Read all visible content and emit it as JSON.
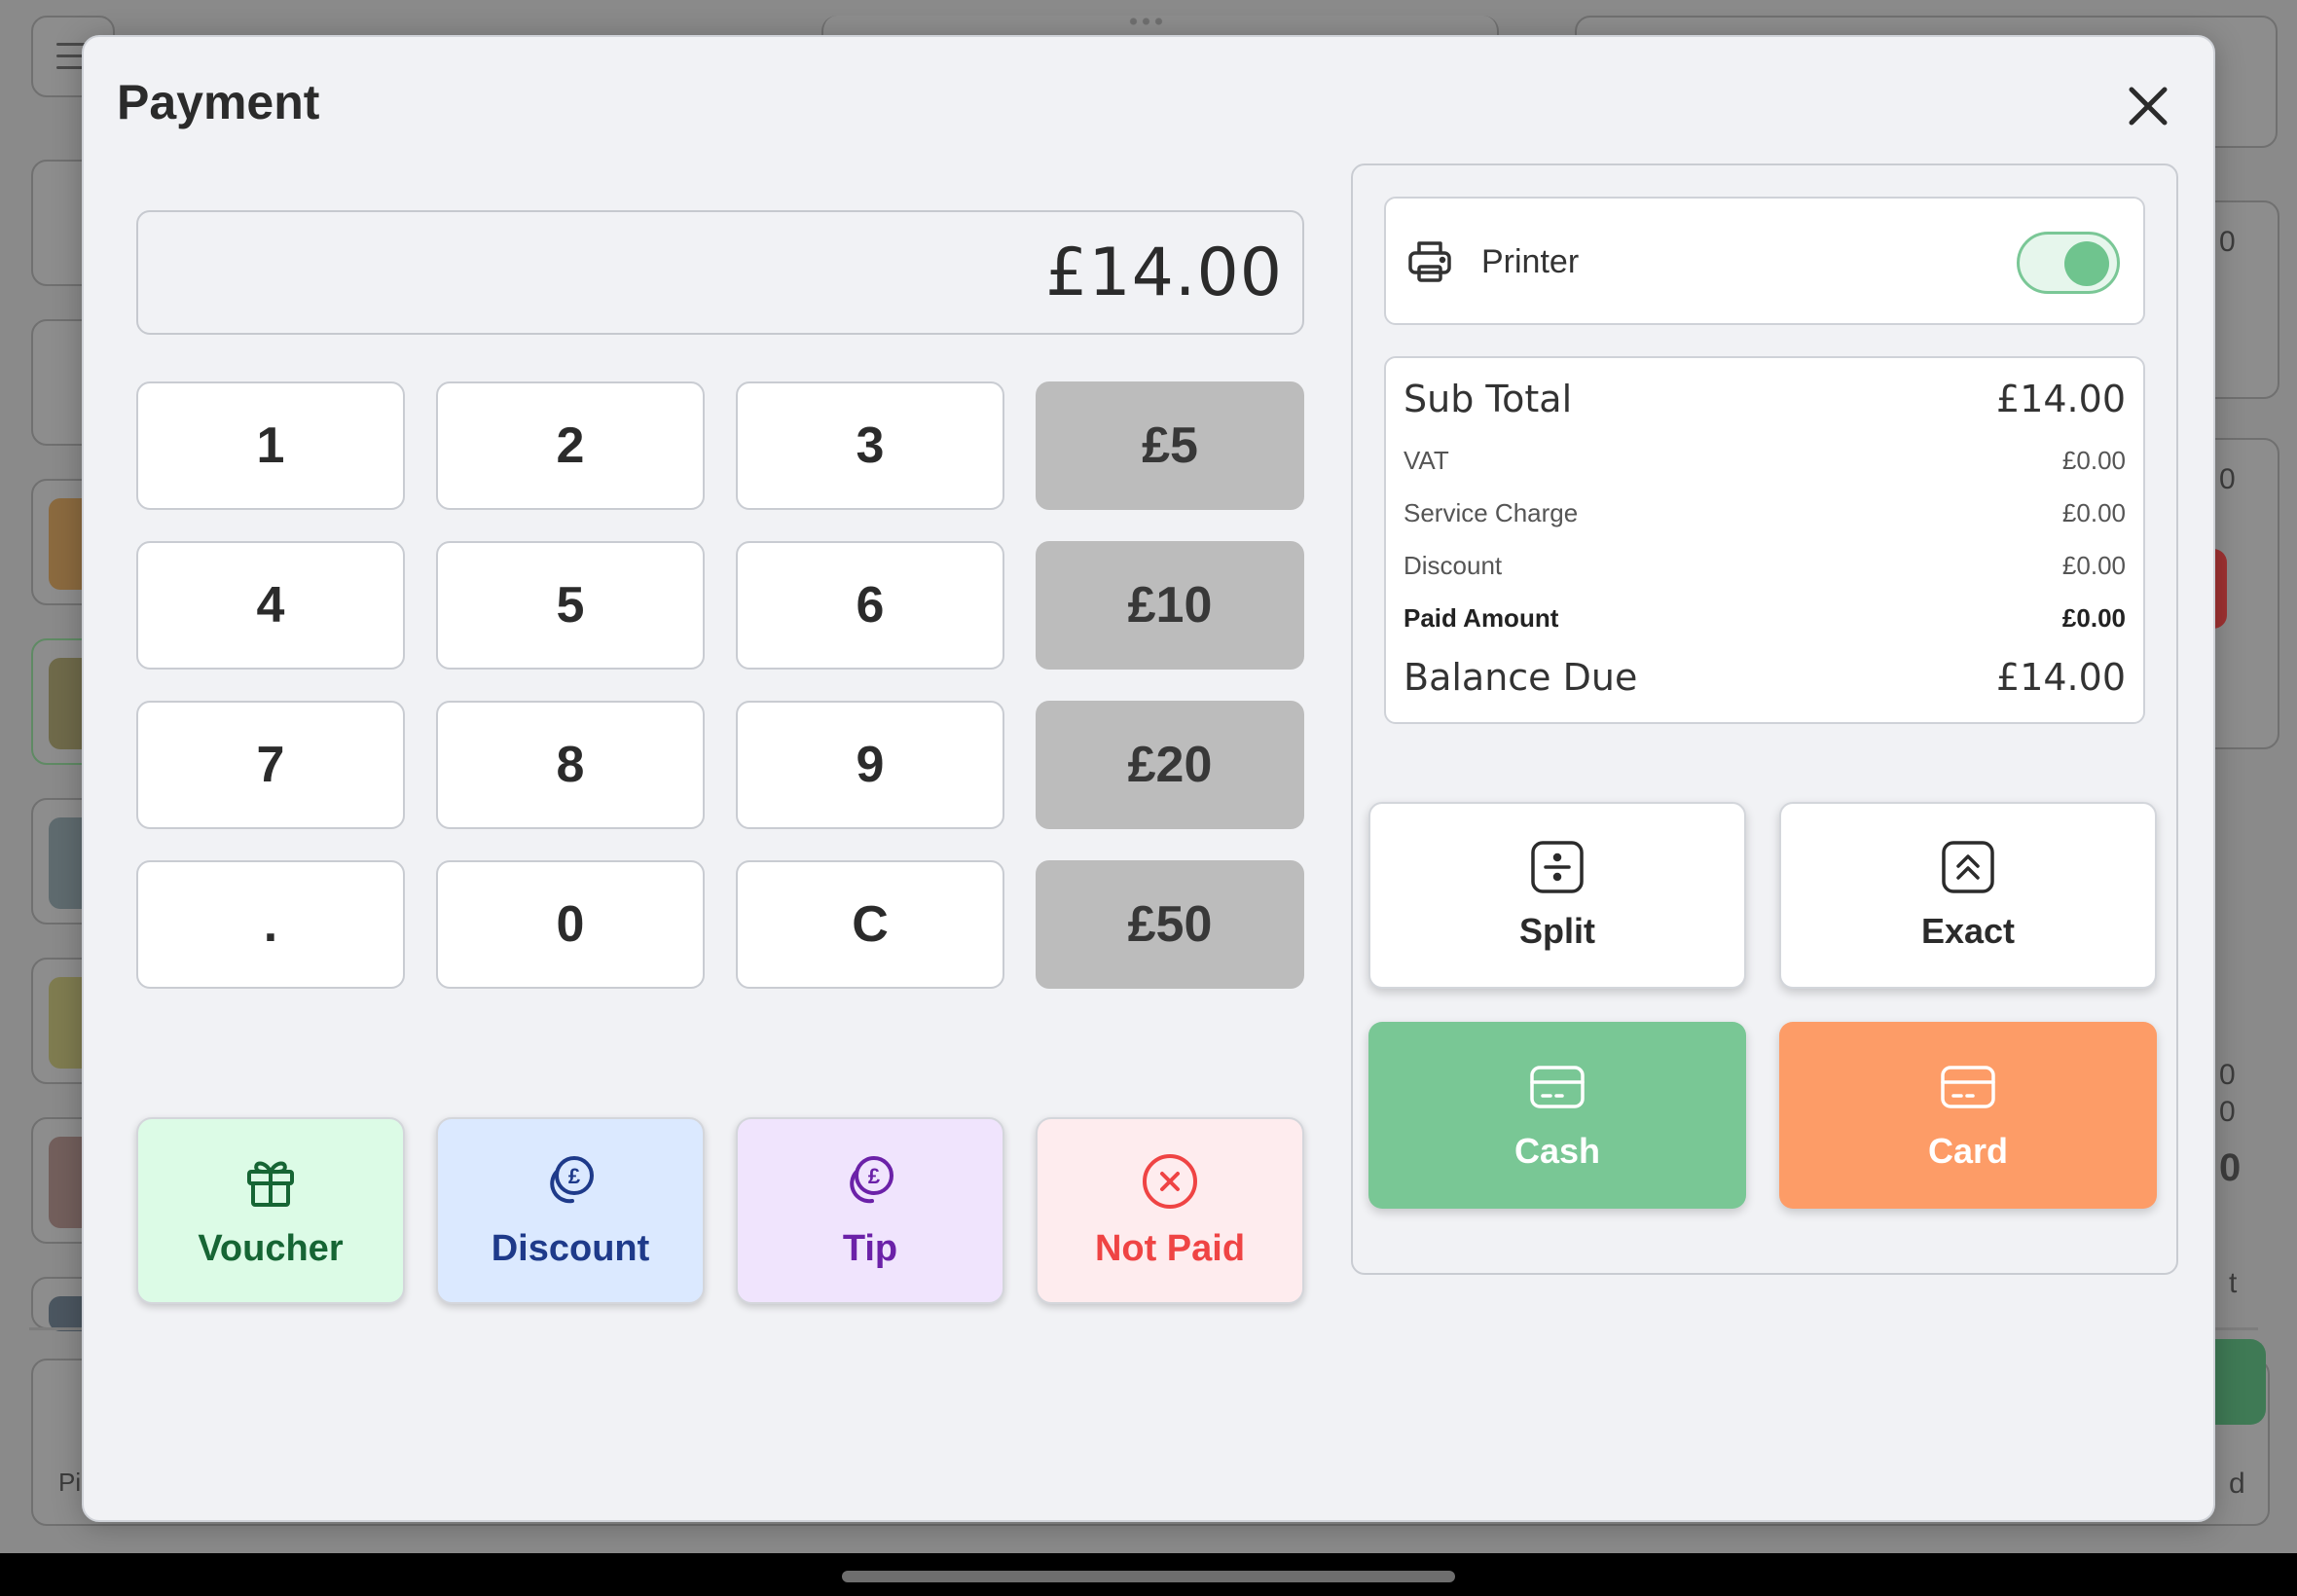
{
  "modal": {
    "title": "Payment",
    "close_icon": "close-icon"
  },
  "amount_display": "£14.00",
  "keypad": {
    "keys": [
      "1",
      "2",
      "3",
      "4",
      "5",
      "6",
      "7",
      "8",
      "9",
      ".",
      "0",
      "C"
    ],
    "quick_amounts": [
      "£5",
      "£10",
      "£20",
      "£50"
    ]
  },
  "actions": {
    "voucher": {
      "label": "Voucher",
      "icon": "gift-icon"
    },
    "discount": {
      "label": "Discount",
      "icon": "pound-coins-icon"
    },
    "tip": {
      "label": "Tip",
      "icon": "pound-coins-icon"
    },
    "not_paid": {
      "label": "Not Paid",
      "icon": "x-circle-icon"
    }
  },
  "printer": {
    "label": "Printer",
    "icon": "printer-icon",
    "enabled": true
  },
  "summary": {
    "sub_total_label": "Sub Total",
    "sub_total": "£14.00",
    "vat_label": "VAT",
    "vat": "£0.00",
    "service_charge_label": "Service Charge",
    "service_charge": "£0.00",
    "discount_label": "Discount",
    "discount": "£0.00",
    "paid_amount_label": "Paid Amount",
    "paid_amount": "£0.00",
    "balance_due_label": "Balance Due",
    "balance_due": "£14.00"
  },
  "payment_methods": {
    "split": {
      "label": "Split",
      "icon": "divide-icon"
    },
    "exact": {
      "label": "Exact",
      "icon": "chevrons-up-icon"
    },
    "cash": {
      "label": "Cash",
      "icon": "card-icon"
    },
    "card": {
      "label": "Card",
      "icon": "card-icon"
    }
  },
  "colors": {
    "cash": "#79c795",
    "card": "#fd9c67",
    "voucher_bg": "#dcfbe6",
    "discount_bg": "#dbe9ff",
    "tip_bg": "#f0e4fd",
    "not_paid_bg": "#feecee",
    "quick_amount_bg": "#bcbcbc"
  },
  "background": {
    "partial_texts": [
      "0",
      "0",
      "0",
      "0",
      "0",
      "t",
      "Pi",
      "d"
    ]
  }
}
